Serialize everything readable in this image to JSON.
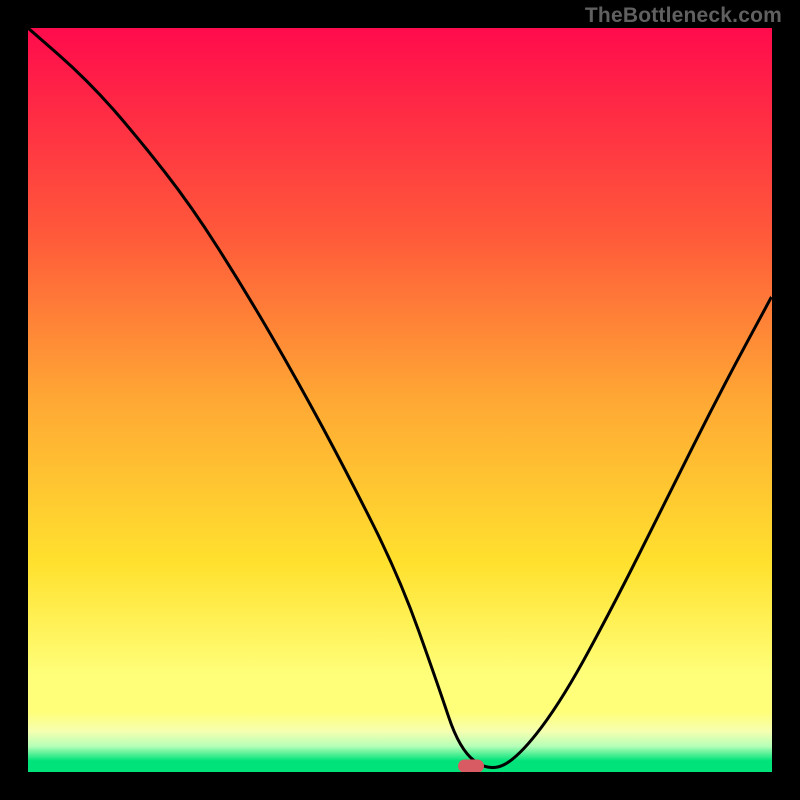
{
  "watermark": "TheBottleneck.com",
  "colors": {
    "frame": "#000000",
    "watermark": "#606060",
    "curve": "#000000",
    "marker": "#d85a63",
    "gradient_top": "#ff0b4c",
    "gradient_mid1": "#ff5a3a",
    "gradient_mid2": "#ffa834",
    "gradient_mid3": "#ffe12e",
    "gradient_band1": "#ffff7a",
    "gradient_band2": "#f6ffb0",
    "gradient_band3": "#b8ffb8",
    "gradient_bottom": "#00e37a"
  },
  "marker": {
    "x_frac": 0.595,
    "y_frac": 0.992
  },
  "chart_data": {
    "type": "line",
    "title": "",
    "xlabel": "",
    "ylabel": "",
    "xlim": [
      0,
      100
    ],
    "ylim": [
      0,
      100
    ],
    "x": [
      0,
      8,
      15,
      22,
      29,
      36,
      43,
      50,
      55,
      58,
      62,
      66,
      72,
      79,
      86,
      93,
      100
    ],
    "values": [
      100,
      93,
      85,
      76,
      65,
      53,
      40,
      26,
      12,
      3,
      0,
      2,
      10,
      23,
      37,
      51,
      64
    ],
    "optimum_x": 60,
    "gradient_scale_meaning": "red=high bottleneck, green=low bottleneck"
  }
}
